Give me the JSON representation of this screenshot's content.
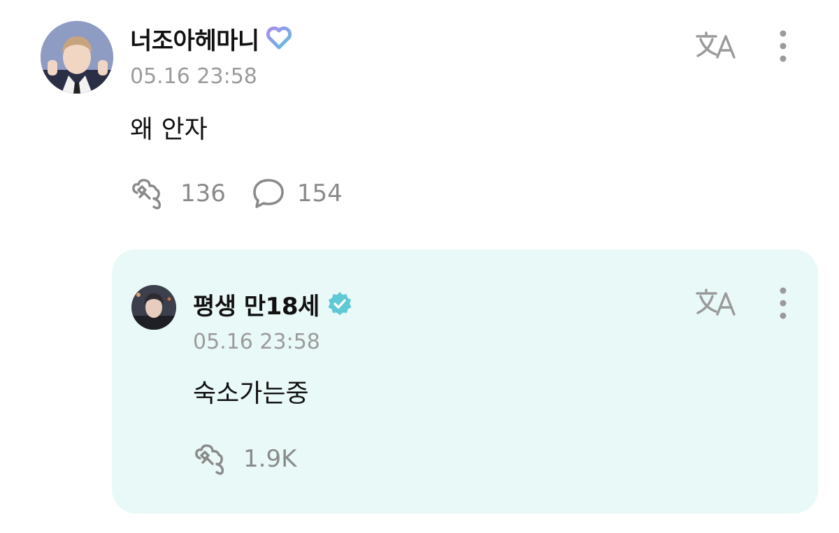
{
  "post": {
    "username": "너조아헤마니",
    "timestamp": "05.16 23:58",
    "text": "왜 안자",
    "likes": "136",
    "comments": "154",
    "badge_color": "#7b8cf0"
  },
  "reply": {
    "username": "평생 만18세",
    "timestamp": "05.16 23:58",
    "text": "숙소가는중",
    "likes": "1.9K",
    "badge_color": "#5fc9d6",
    "card_color": "#e9f9f7"
  },
  "icons": {
    "translate": "translate-icon",
    "more": "more-vertical-icon",
    "like": "like-icon",
    "comment": "comment-icon"
  }
}
